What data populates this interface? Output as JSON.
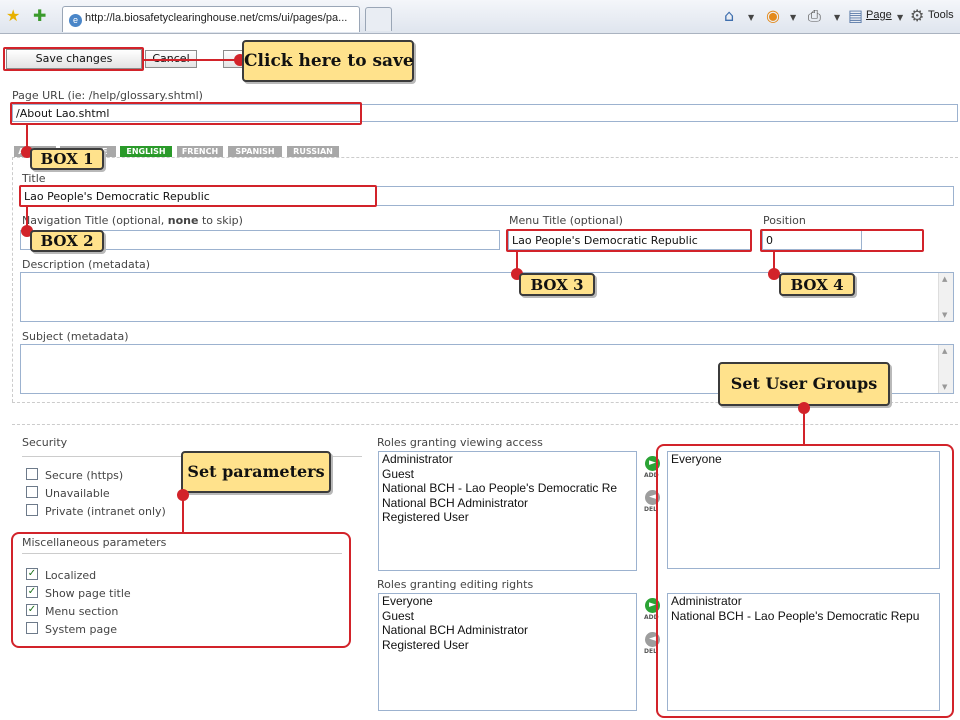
{
  "browser": {
    "url": "http://la.biosafetyclearinghouse.net/cms/ui/pages/pa...",
    "page_menu": "Page",
    "tools_menu": "Tools"
  },
  "toolbar": {
    "save_label": "Save changes",
    "cancel_label": "Cancel"
  },
  "page_url": {
    "label": "Page URL (ie: /help/glossary.shtml)",
    "value": "/About Lao.shtml"
  },
  "languages": [
    {
      "label": "ARABIC",
      "active": false
    },
    {
      "label": "CHINESE",
      "active": false
    },
    {
      "label": "ENGLISH",
      "active": true
    },
    {
      "label": "FRENCH",
      "active": false
    },
    {
      "label": "SPANISH",
      "active": false
    },
    {
      "label": "RUSSIAN",
      "active": false
    }
  ],
  "fields": {
    "title_label": "Title",
    "title_value": "Lao People's Democratic Republic",
    "nav_title_label_pre": "Navigation Title (optional, ",
    "nav_title_label_bold": "none",
    "nav_title_label_post": " to skip)",
    "nav_title_value": "",
    "menu_title_label": "Menu Title (optional)",
    "menu_title_value": "Lao People's Democratic Republic",
    "position_label": "Position",
    "position_value": "0",
    "description_label": "Description (metadata)",
    "subject_label": "Subject (metadata)"
  },
  "security": {
    "title": "Security",
    "options": [
      {
        "label": "Secure (https)",
        "checked": false
      },
      {
        "label": "Unavailable",
        "checked": false
      },
      {
        "label": "Private (intranet only)",
        "checked": false
      }
    ]
  },
  "misc": {
    "title": "Miscellaneous parameters",
    "options": [
      {
        "label": "Localized",
        "checked": true
      },
      {
        "label": "Show page title",
        "checked": true
      },
      {
        "label": "Menu section",
        "checked": true
      },
      {
        "label": "System page",
        "checked": false
      }
    ]
  },
  "roles": {
    "viewing_title": "Roles granting viewing access",
    "viewing_available": [
      "Administrator",
      "Guest",
      "National BCH - Lao People's Democratic Re",
      "National BCH Administrator",
      "Registered User"
    ],
    "viewing_selected": [
      "Everyone"
    ],
    "editing_title": "Roles granting editing rights",
    "editing_available": [
      "Everyone",
      "Guest",
      "National BCH Administrator",
      "Registered User"
    ],
    "editing_selected": [
      "Administrator",
      "National BCH - Lao People's Democratic Repu"
    ],
    "add_label": "ADD",
    "del_label": "DEL"
  },
  "annotations": {
    "save_callout": "Click here to save",
    "box1": "BOX 1",
    "box2": "BOX 2",
    "box3": "BOX 3",
    "box4": "BOX 4",
    "user_groups": "Set User Groups",
    "parameters": "Set parameters"
  },
  "colors": {
    "annotation_red": "#d2232a",
    "callout_yellow": "#ffe28c",
    "active_language": "#2a9a2a",
    "field_border": "#9cb2cf"
  }
}
